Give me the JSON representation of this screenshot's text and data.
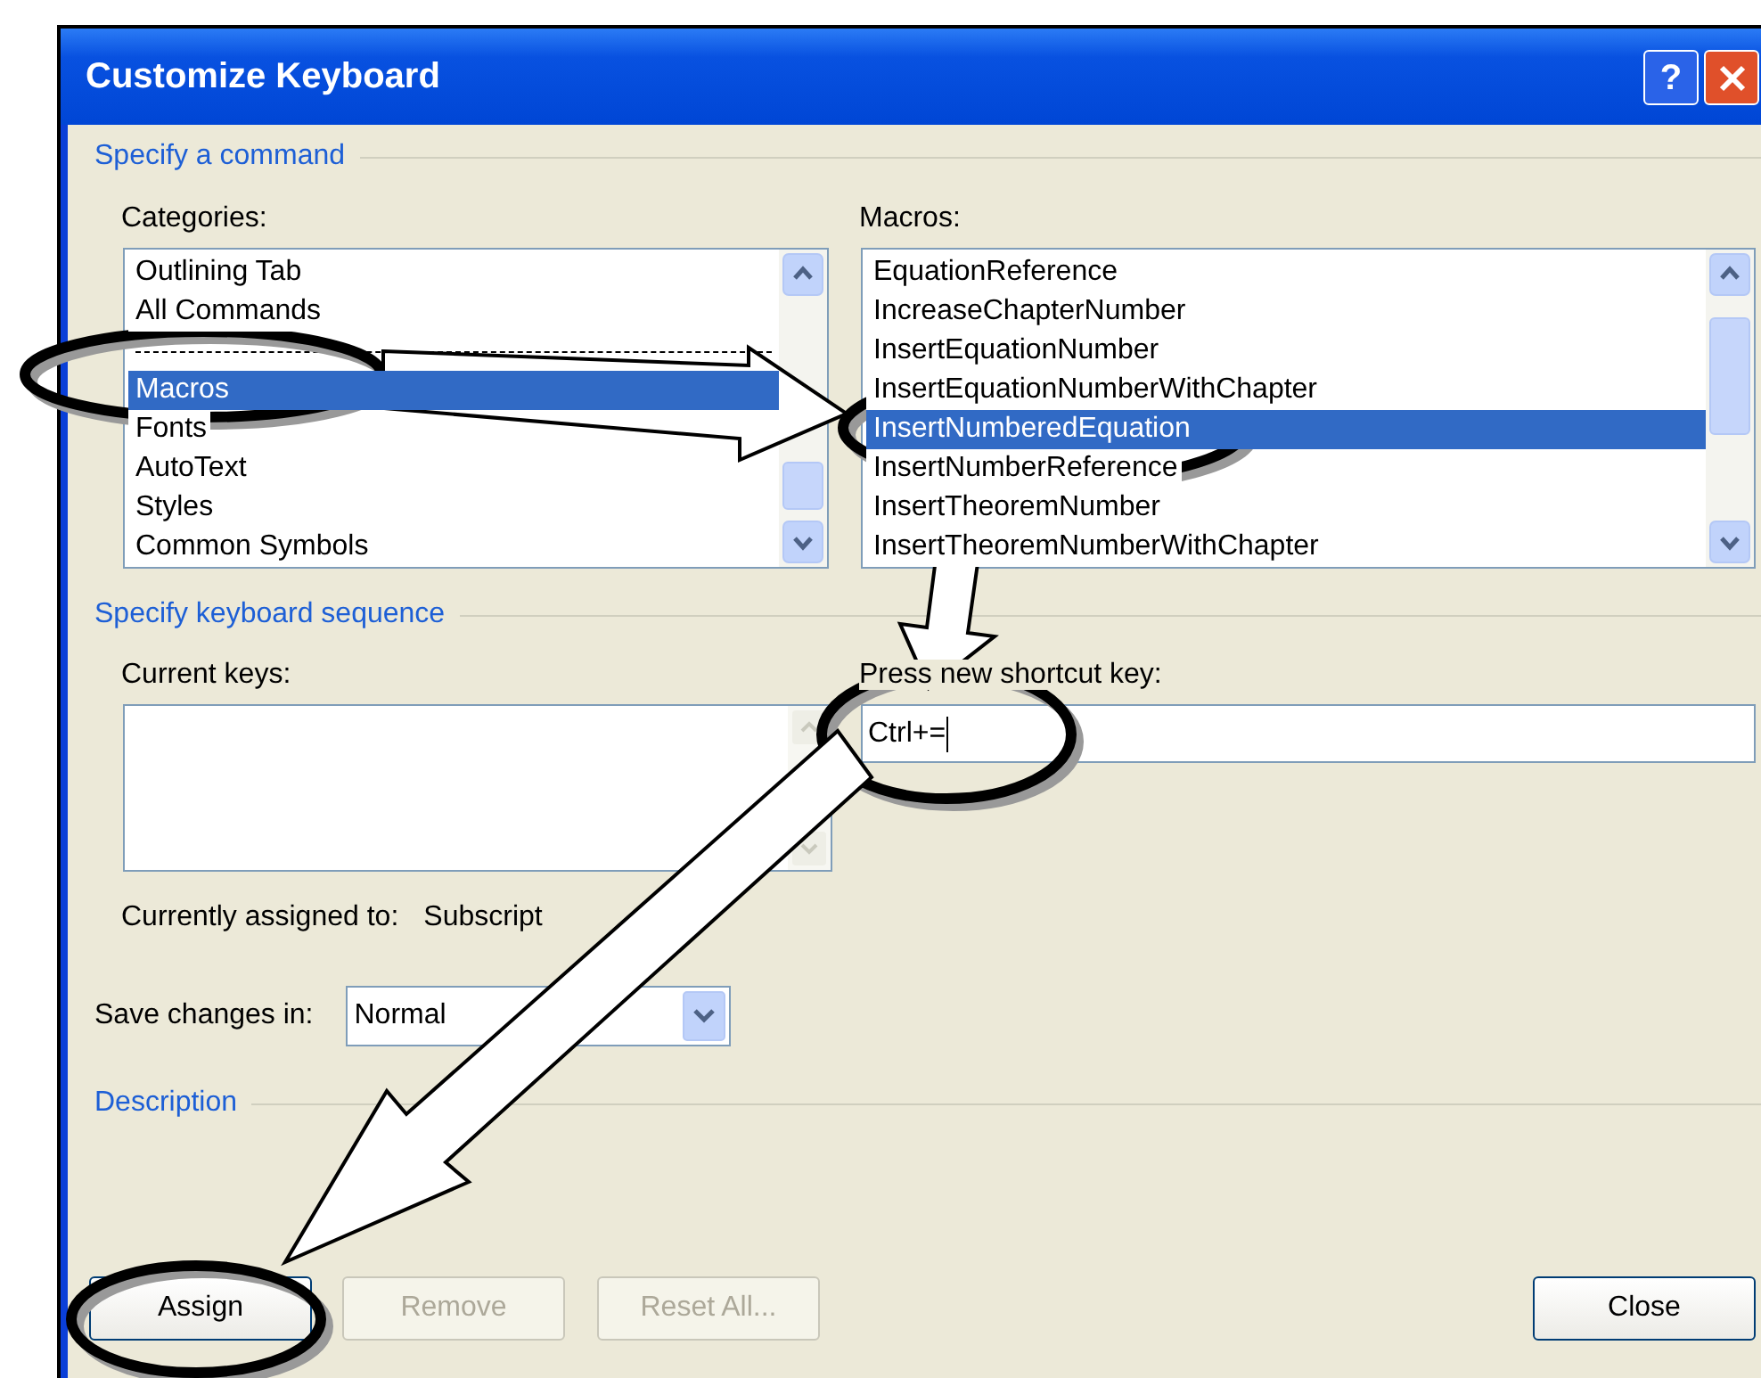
{
  "window": {
    "title": "Customize Keyboard",
    "help_button": "?"
  },
  "command_section": {
    "header": "Specify a command",
    "categories": {
      "label": "Categories:",
      "items": [
        {
          "kind": "item",
          "label": "Outlining Tab",
          "selected": false
        },
        {
          "kind": "item",
          "label": "All Commands",
          "selected": false
        },
        {
          "kind": "separator",
          "selected": false
        },
        {
          "kind": "item",
          "label": "Macros",
          "selected": true
        },
        {
          "kind": "item",
          "label": "Fonts",
          "selected": false
        },
        {
          "kind": "item",
          "label": "AutoText",
          "selected": false
        },
        {
          "kind": "item",
          "label": "Styles",
          "selected": false
        },
        {
          "kind": "item",
          "label": "Common Symbols",
          "selected": false
        }
      ]
    },
    "macros": {
      "label": "Macros:",
      "items": [
        {
          "kind": "item",
          "label": "EquationReference",
          "selected": false
        },
        {
          "kind": "item",
          "label": "IncreaseChapterNumber",
          "selected": false
        },
        {
          "kind": "item",
          "label": "InsertEquationNumber",
          "selected": false
        },
        {
          "kind": "item",
          "label": "InsertEquationNumberWithChapter",
          "selected": false
        },
        {
          "kind": "item",
          "label": "InsertNumberedEquation",
          "selected": true
        },
        {
          "kind": "item",
          "label": "InsertNumberReference",
          "selected": false
        },
        {
          "kind": "item",
          "label": "InsertTheoremNumber",
          "selected": false
        },
        {
          "kind": "item",
          "label": "InsertTheoremNumberWithChapter",
          "selected": false
        }
      ]
    }
  },
  "keyboard_section": {
    "header": "Specify keyboard sequence",
    "current_keys_label": "Current keys:",
    "new_key_label": "Press new shortcut key:",
    "new_key_value": "Ctrl+=",
    "assigned_label": "Currently assigned to:",
    "assigned_value": "Subscript"
  },
  "save_changes": {
    "label": "Save changes in:",
    "value": "Normal"
  },
  "description_header": "Description",
  "buttons": [
    {
      "label": "Assign",
      "disabled": false
    },
    {
      "label": "Remove",
      "disabled": true
    },
    {
      "label": "Reset All...",
      "disabled": true
    },
    {
      "label": "Close",
      "disabled": false
    }
  ]
}
